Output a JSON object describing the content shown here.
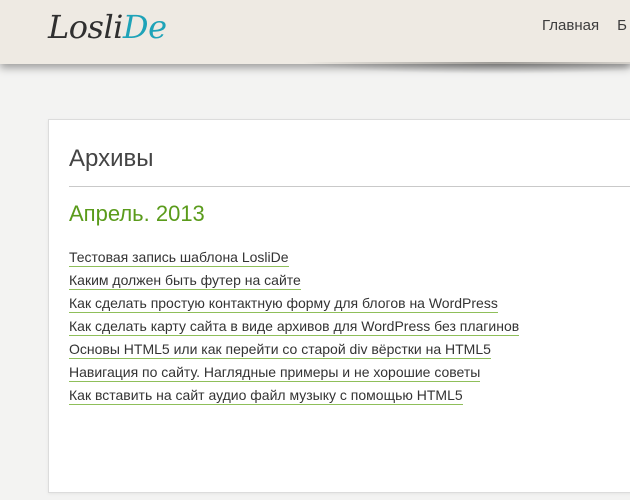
{
  "site": {
    "logo_main": "Losli",
    "logo_accent": "De"
  },
  "nav": {
    "items": [
      {
        "label": "Главная"
      },
      {
        "label": "Б"
      }
    ]
  },
  "main": {
    "page_title": "Архивы",
    "month_heading": "Апрель. 2013",
    "posts": [
      {
        "title": "Тестовая запись шаблона LosliDe"
      },
      {
        "title": "Каким должен быть футер на сайте"
      },
      {
        "title": "Как сделать простую контактную форму для блогов на WordPress"
      },
      {
        "title": "Как сделать карту сайта в виде архивов для WordPress без плагинов"
      },
      {
        "title": "Основы HTML5 или как перейти со старой div вёрстки на HTML5"
      },
      {
        "title": "Навигация по сайту. Наглядные примеры и не хорошие советы"
      },
      {
        "title": "Как вставить на сайт аудио файл музыку с помощью HTML5"
      }
    ]
  },
  "colors": {
    "header_bg": "#eeeae3",
    "logo_accent": "#1ea3b8",
    "month_heading": "#5a9b1b",
    "link_underline": "#8fbf5a"
  }
}
